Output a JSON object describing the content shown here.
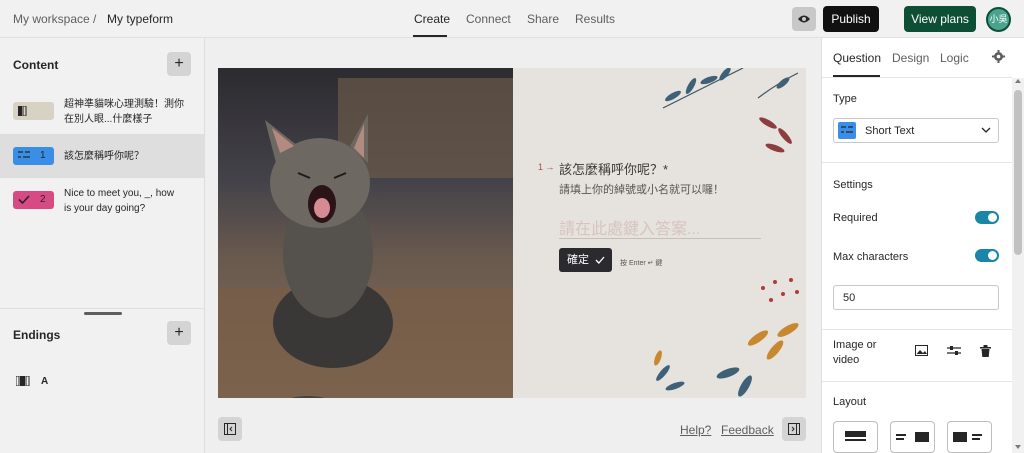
{
  "topbar": {
    "workspace": "My workspace",
    "separator": "/",
    "form_name": "My typeform",
    "tabs": [
      {
        "label": "Create",
        "active": true
      },
      {
        "label": "Connect",
        "active": false
      },
      {
        "label": "Share",
        "active": false
      },
      {
        "label": "Results",
        "active": false
      }
    ],
    "publish_label": "Publish",
    "view_plans_label": "View plans",
    "avatar_text": "小吳"
  },
  "sidebar": {
    "content_title": "Content",
    "add_label": "+",
    "items": [
      {
        "number": "",
        "text": "超神準貓咪心理測驗！測你在別人眼...什麼樣子",
        "badge_color": "#d8d2c5",
        "icon": "welcome-screen-icon"
      },
      {
        "number": "1",
        "text": "該怎麼稱呼你呢？",
        "badge_color": "#3a8ee6",
        "icon": "short-text-icon",
        "selected": true
      },
      {
        "number": "2",
        "text": "Nice to meet you, _, how is your day going?",
        "badge_color": "#d84a84",
        "icon": "checkmark-icon"
      }
    ],
    "endings_title": "Endings",
    "ending_item": {
      "label": "A",
      "icon": "ending-screen-icon"
    }
  },
  "preview": {
    "question_arrow": "1 →",
    "question_title": "該怎麼稱呼你呢？*",
    "question_description": "請填上你的綽號或小名就可以囉！",
    "answer_placeholder": "請在此處鍵入答案...",
    "ok_label": "確定",
    "enter_hint": "按 Enter ↵ 鍵"
  },
  "footer": {
    "help_label": "Help?",
    "feedback_label": "Feedback"
  },
  "panel": {
    "tabs": [
      {
        "label": "Question",
        "active": true
      },
      {
        "label": "Design",
        "active": false
      },
      {
        "label": "Logic",
        "active": false
      }
    ],
    "type_label": "Type",
    "type_value": "Short Text",
    "settings_label": "Settings",
    "required_label": "Required",
    "required_on": true,
    "max_chars_label": "Max characters",
    "max_chars_on": true,
    "max_chars_value": "50",
    "image_video_label": "Image or video",
    "layout_label": "Layout"
  },
  "colors": {
    "accent_toggle": "#1a86a7",
    "publish_bg": "#111111",
    "view_plans_bg": "#0d4f34",
    "short_text_blue": "#3a8ee6",
    "yes_no_pink": "#d84a84"
  }
}
